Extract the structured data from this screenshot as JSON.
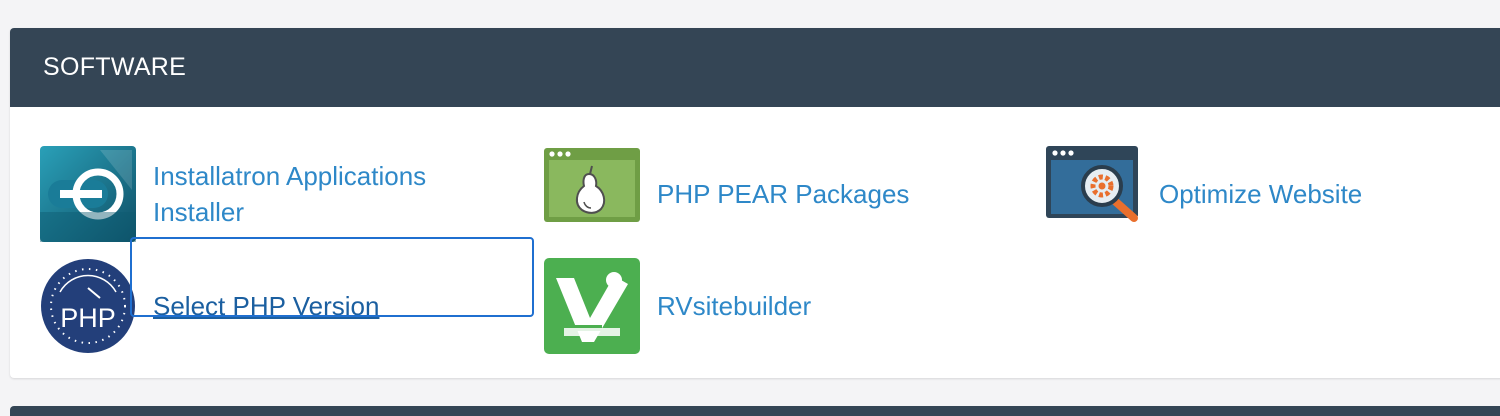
{
  "section": {
    "title": "SOFTWARE"
  },
  "items": [
    {
      "label": "Installatron Applications Installer",
      "icon": "installatron-icon"
    },
    {
      "label": "PHP PEAR Packages",
      "icon": "pear-icon"
    },
    {
      "label": "Optimize Website",
      "icon": "optimize-icon"
    },
    {
      "label": "Select PHP Version",
      "icon": "php-icon",
      "focused": true
    },
    {
      "label": "RVsitebuilder",
      "icon": "rvsitebuilder-icon"
    }
  ],
  "colors": {
    "header_bg": "#344555",
    "link": "#2e88c8",
    "focus_ring": "#1f6fd0"
  }
}
